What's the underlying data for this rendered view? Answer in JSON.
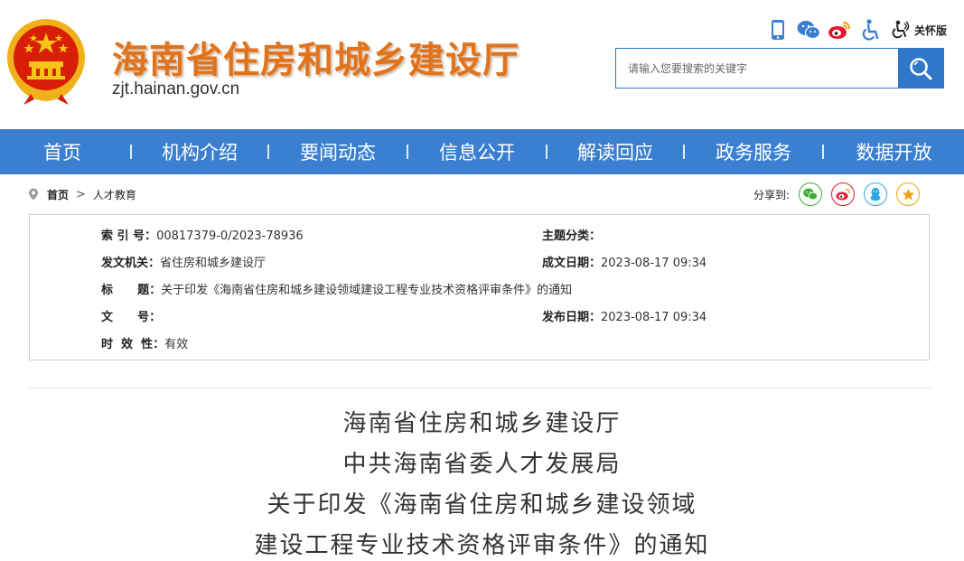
{
  "header": {
    "title": "海南省住房和城乡建设厅",
    "domain": "zjt.hainan.gov.cn",
    "care_mode_label": "关怀版",
    "tools": [
      "mobile-icon",
      "wechat-icon",
      "weibo-icon",
      "accessibility-icon",
      "care-mode-icon"
    ]
  },
  "search": {
    "placeholder": "请输入您要搜索的关键字"
  },
  "nav": {
    "items": [
      "首页",
      "机构介绍",
      "要闻动态",
      "信息公开",
      "解读回应",
      "政务服务",
      "数据开放"
    ]
  },
  "breadcrumb": {
    "home": "首页",
    "separator": ">",
    "current": "人才教育"
  },
  "share": {
    "label": "分享到:",
    "targets": [
      "wechat",
      "weibo",
      "qq",
      "qzone"
    ]
  },
  "info": {
    "index_label": "索  引  号：",
    "index_value": "00817379-0/2023-78936",
    "topic_label": "主题分类：",
    "topic_value": "",
    "issuer_label": "发文机关：",
    "issuer_value": "省住房和城乡建设厅",
    "created_label": "成文日期：",
    "created_value": "2023-08-17 09:34",
    "title_label": "标      题：",
    "title_value": "关于印发《海南省住房和城乡建设领域建设工程专业技术资格评审条件》的通知",
    "docno_label": "文      号：",
    "docno_value": "",
    "published_label": "发布日期：",
    "published_value": "2023-08-17 09:34",
    "validity_label": "时  效  性：",
    "validity_value": "有效"
  },
  "article": {
    "title_lines": [
      "海南省住房和城乡建设厅",
      "中共海南省委人才发展局",
      "关于印发《海南省住房和城乡建设领域",
      "建设工程专业技术资格评审条件》的通知"
    ]
  },
  "colors": {
    "nav_blue": "#3a7fd0",
    "title_orange": "#e0731c",
    "emblem_red": "#d81e06",
    "emblem_gold": "#f5c518"
  }
}
